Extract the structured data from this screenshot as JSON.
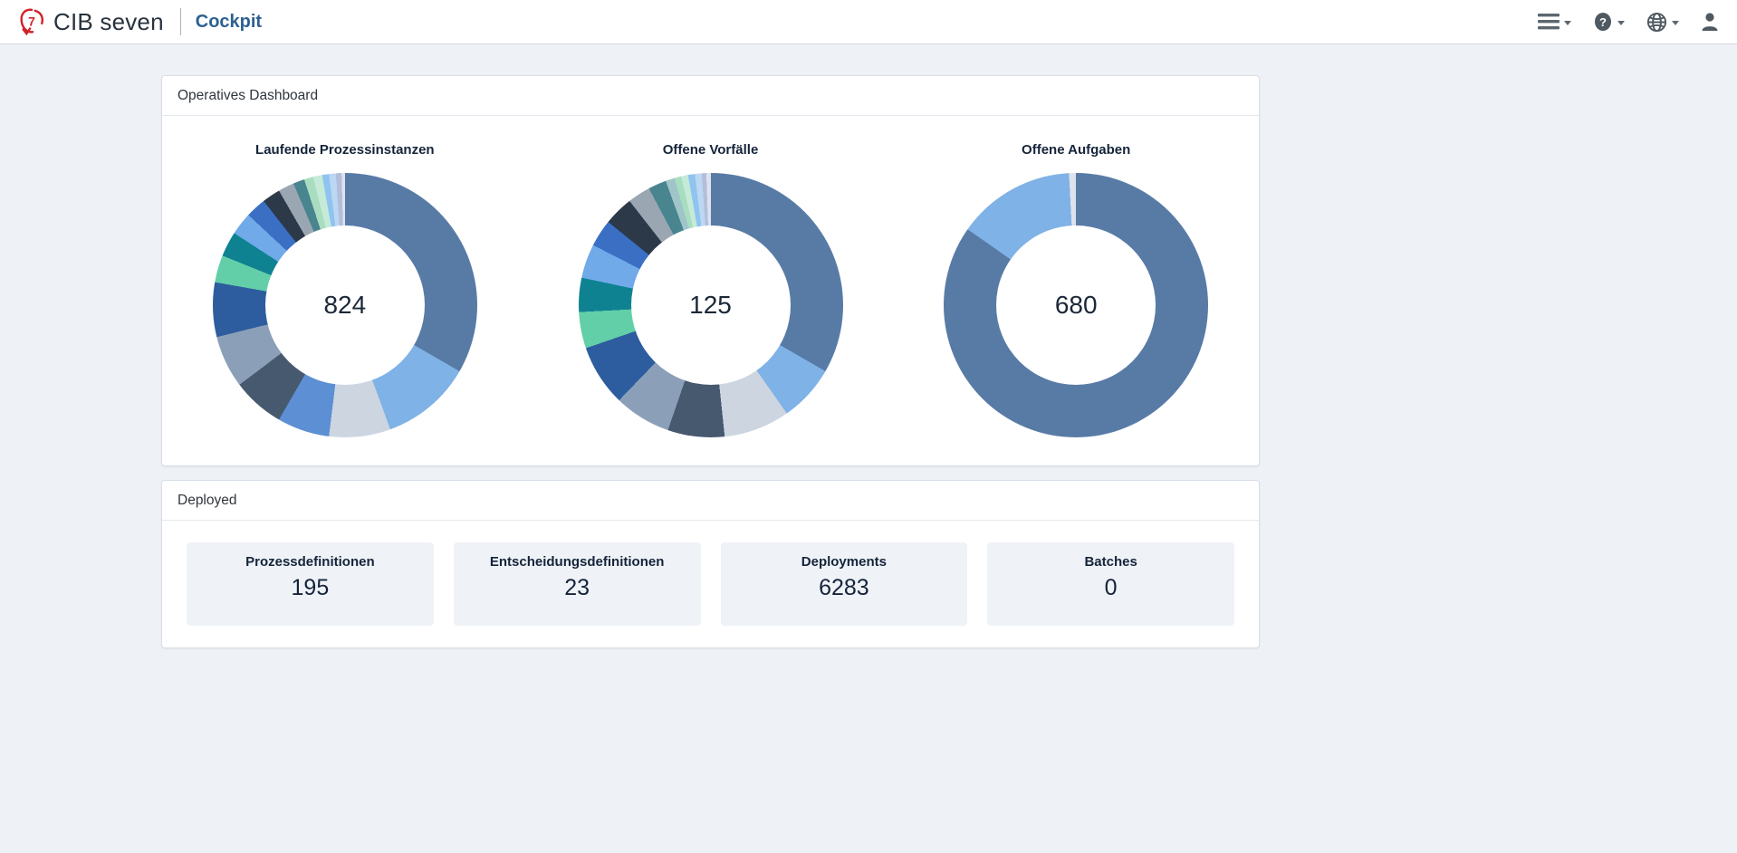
{
  "navbar": {
    "brand": "CIB seven",
    "app_name": "Cockpit",
    "icons": [
      {
        "name": "menu-icon"
      },
      {
        "name": "help-icon"
      },
      {
        "name": "language-globe-icon"
      },
      {
        "name": "user-icon"
      }
    ],
    "brand_red": "#d2232a",
    "app_name_color": "#2d6091"
  },
  "dashboard_card": {
    "title": "Operatives Dashboard"
  },
  "deployed_card": {
    "title": "Deployed",
    "stats": [
      {
        "label": "Prozessdefinitionen",
        "value": "195"
      },
      {
        "label": "Entscheidungsdefinitionen",
        "value": "23"
      },
      {
        "label": "Deployments",
        "value": "6283"
      },
      {
        "label": "Batches",
        "value": "0"
      }
    ]
  },
  "chart_data": [
    {
      "type": "donut",
      "title": "Laufende Prozessinstanzen",
      "total": "824",
      "center_label": "824",
      "legend": "none",
      "segments": [
        {
          "color": "#587ba6",
          "angle_deg": 120
        },
        {
          "color": "#7fb2e6",
          "angle_deg": 40
        },
        {
          "color": "#cdd5e1",
          "angle_deg": 27
        },
        {
          "color": "#5c8fd3",
          "angle_deg": 23
        },
        {
          "color": "#47596e",
          "angle_deg": 23
        },
        {
          "color": "#8ba0b8",
          "angle_deg": 23
        },
        {
          "color": "#2d5d9e",
          "angle_deg": 24
        },
        {
          "color": "#63cfa8",
          "angle_deg": 12
        },
        {
          "color": "#0f8292",
          "angle_deg": 11
        },
        {
          "color": "#70aae8",
          "angle_deg": 10
        },
        {
          "color": "#3a6fc4",
          "angle_deg": 9
        },
        {
          "color": "#2b3949",
          "angle_deg": 8
        },
        {
          "color": "#9ba6b3",
          "angle_deg": 7
        },
        {
          "color": "#49858f",
          "angle_deg": 5
        },
        {
          "color": "#a9ddc0",
          "angle_deg": 4
        },
        {
          "color": "#c5ebd8",
          "angle_deg": 4
        },
        {
          "color": "#8fc3f0",
          "angle_deg": 3
        },
        {
          "color": "#bcd7f2",
          "angle_deg": 3
        },
        {
          "color": "#b3bedb",
          "angle_deg": 2.5
        },
        {
          "color": "#dde2ec",
          "angle_deg": 1.5
        }
      ]
    },
    {
      "type": "donut",
      "title": "Offene Vorfälle",
      "total": "125",
      "center_label": "125",
      "legend": "none",
      "segments": [
        {
          "color": "#587ba6",
          "angle_deg": 120
        },
        {
          "color": "#7fb2e6",
          "angle_deg": 25
        },
        {
          "color": "#cdd5e1",
          "angle_deg": 29
        },
        {
          "color": "#47596e",
          "angle_deg": 25
        },
        {
          "color": "#8ba0b8",
          "angle_deg": 25
        },
        {
          "color": "#2d5d9e",
          "angle_deg": 27
        },
        {
          "color": "#63cfa8",
          "angle_deg": 16
        },
        {
          "color": "#0f8292",
          "angle_deg": 15
        },
        {
          "color": "#70aae8",
          "angle_deg": 15
        },
        {
          "color": "#3a6fc4",
          "angle_deg": 12
        },
        {
          "color": "#2b3949",
          "angle_deg": 13
        },
        {
          "color": "#9ba6b3",
          "angle_deg": 10
        },
        {
          "color": "#49858f",
          "angle_deg": 8
        },
        {
          "color": "#9fc5c9",
          "angle_deg": 4
        },
        {
          "color": "#a9ddc0",
          "angle_deg": 3
        },
        {
          "color": "#c5ebd8",
          "angle_deg": 3
        },
        {
          "color": "#8fc3f0",
          "angle_deg": 3
        },
        {
          "color": "#bcd7f2",
          "angle_deg": 3
        },
        {
          "color": "#b3bedb",
          "angle_deg": 2
        },
        {
          "color": "#dde2ec",
          "angle_deg": 2
        }
      ]
    },
    {
      "type": "donut",
      "title": "Offene Aufgaben",
      "total": "680",
      "center_label": "680",
      "legend": "none",
      "segments": [
        {
          "color": "#587ba6",
          "angle_deg": 305
        },
        {
          "color": "#7fb2e6",
          "angle_deg": 52
        },
        {
          "color": "#dde2ec",
          "angle_deg": 3
        }
      ]
    }
  ]
}
